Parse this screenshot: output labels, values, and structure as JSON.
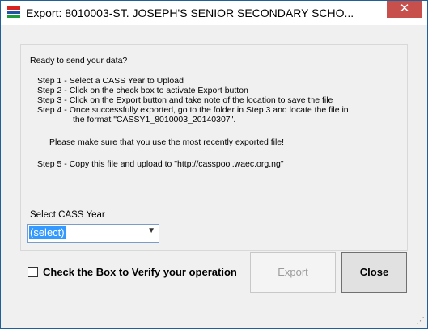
{
  "window": {
    "title": "Export: 8010003-ST. JOSEPH'S SENIOR SECONDARY SCHO..."
  },
  "titlebar": {
    "close_glyph": "✕"
  },
  "instructions": {
    "heading": "Ready to send your data?",
    "step1": "Step 1 - Select a CASS Year to Upload",
    "step2": "Step 2 - Click on the check box to activate Export button",
    "step3": "Step 3 - Click on the Export button and take note of the location to save the file",
    "step4": "Step 4 - Once successfully exported, go to the folder in Step 3 and locate the file in",
    "step4_cont": "the format  \"CASSY1_8010003_20140307\".",
    "note": "Please make sure that you use the most recently exported file!",
    "step5": "Step 5 - Copy this file and upload to \"http://casspool.waec.org.ng\""
  },
  "year_select": {
    "label": "Select CASS Year",
    "value": "(select)"
  },
  "verify": {
    "label": "Check the Box to Verify your operation",
    "checked": false
  },
  "buttons": {
    "export": "Export",
    "close": "Close"
  }
}
